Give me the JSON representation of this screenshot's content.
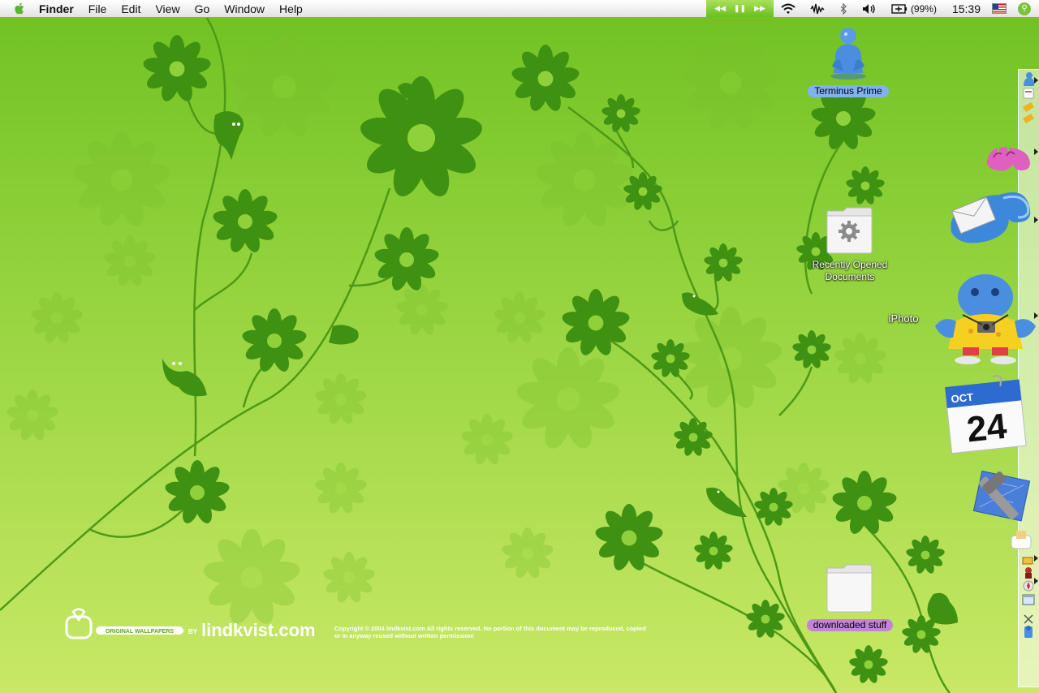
{
  "menubar": {
    "app_name": "Finder",
    "items": [
      "File",
      "Edit",
      "View",
      "Go",
      "Window",
      "Help"
    ],
    "battery": "(99%)",
    "clock": "15:39"
  },
  "desktop": {
    "icons": [
      {
        "label": "Terminus Prime"
      },
      {
        "label": "Recently Opened\nDocuments"
      },
      {
        "label": "iPhoto"
      },
      {
        "label": "downloaded stuff"
      }
    ]
  },
  "dock": {
    "calendar": {
      "month": "OCT",
      "day": "24"
    }
  },
  "wallpaper": {
    "brand_badge": "ORIGINAL WALLPAPERS",
    "by": "BY",
    "brand": "lindkvist.com",
    "copyright": "Copyright © 2004 lindkvist.com All rights reserved. No portion of this document may be reproduced, copied or in anyway reused without written permission!"
  },
  "colors": {
    "accent": "#7fb2ef",
    "folder_label": "#c483d8",
    "background": "#8fd13a"
  }
}
